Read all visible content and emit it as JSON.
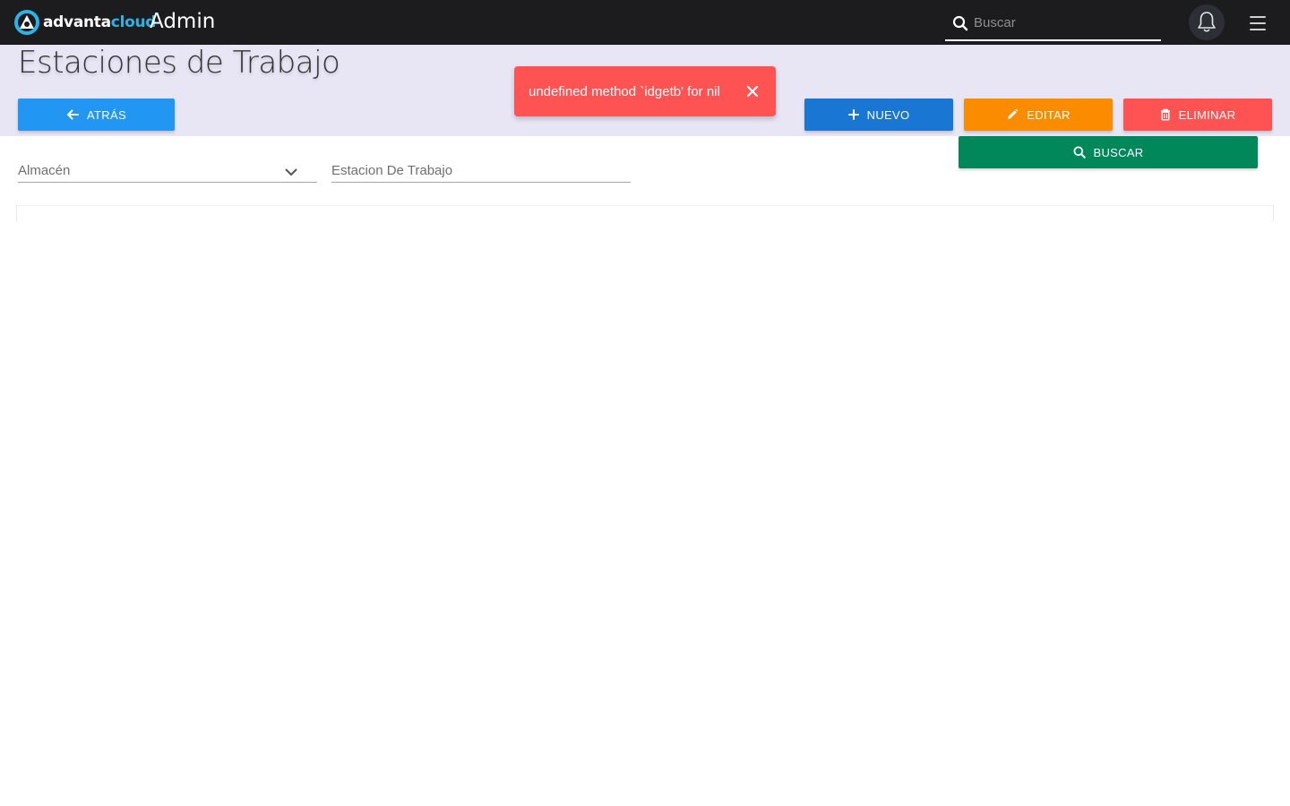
{
  "app": {
    "logo_text_primary": "advanta",
    "logo_text_secondary": "cloud",
    "title": "Admin"
  },
  "topbar": {
    "search_placeholder": "Buscar",
    "search_value": "",
    "icons": [
      "search-icon",
      "bell-icon",
      "hamburger-menu-icon"
    ]
  },
  "page": {
    "title": "Estaciones de Trabajo"
  },
  "actions": {
    "back_label": "ATRÁS",
    "new_label": "NUEVO",
    "edit_label": "EDITAR",
    "delete_label": "ELIMINAR",
    "search_label": "BUSCAR"
  },
  "toast": {
    "message": "undefined method `idgetb' for nil",
    "type": "error"
  },
  "filters": {
    "almacen_label": "Almacén",
    "almacen_value": "",
    "estacion_label": "Estacion De Trabajo",
    "estacion_value": ""
  },
  "colors": {
    "topbar": "#1c1c1e",
    "header_band": "#e8e6f5",
    "back_button": "#2196f3",
    "new_button": "#1976d2",
    "edit_button": "#fb8c00",
    "delete_button": "#ff5252",
    "search_button": "#00875a",
    "toast": "#ff5252",
    "brand_accent": "#2bb3e8"
  }
}
